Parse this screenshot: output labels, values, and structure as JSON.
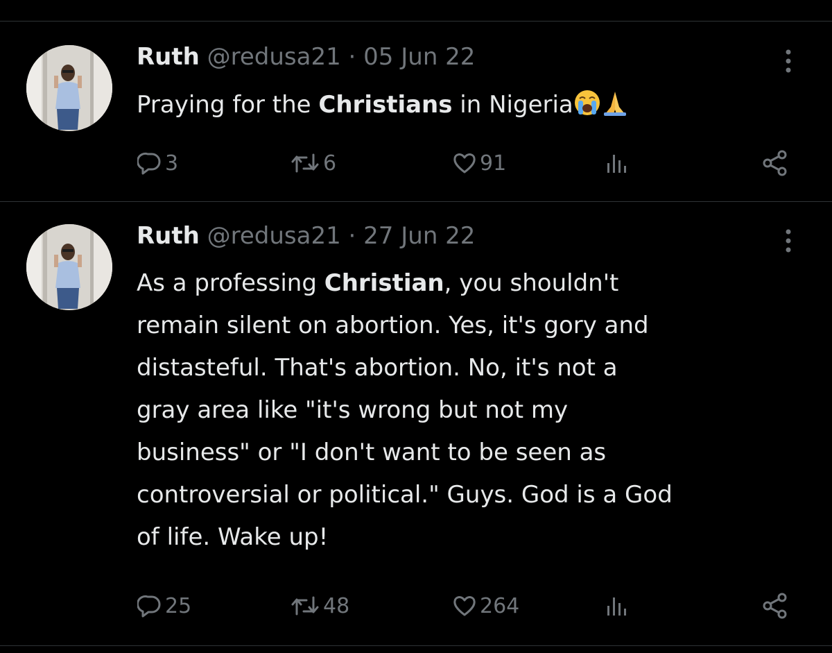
{
  "tweets": [
    {
      "author_name": "Ruth",
      "meta": "@redusa21 · 05 Jun 22",
      "text_parts": [
        "Praying for the ",
        "Christians",
        " in Nigeria"
      ],
      "emojis": [
        "loudly-crying-face",
        "folded-hands"
      ],
      "replies": "3",
      "retweets": "6",
      "likes": "91"
    },
    {
      "author_name": "Ruth",
      "meta": "@redusa21 · 27 Jun 22",
      "lines": [
        [
          "As a professing ",
          "Christian",
          ", you shouldn't"
        ],
        "remain silent on abortion. Yes, it's gory and",
        "distasteful. That's abortion. No, it's not a",
        "gray area like \"it's wrong but not my",
        "business\" or \"I don't want to be seen as",
        "controversial or political.\" Guys. God is a God",
        "of life. Wake up!"
      ],
      "replies": "25",
      "retweets": "48",
      "likes": "264"
    }
  ],
  "icons": [
    "more-icon",
    "reply-icon",
    "retweet-icon",
    "like-icon",
    "views-icon",
    "share-icon"
  ],
  "colors": {
    "background": "#000000",
    "text": "#e7e9ea",
    "secondary": "#71767b",
    "divider": "#2f3336"
  }
}
